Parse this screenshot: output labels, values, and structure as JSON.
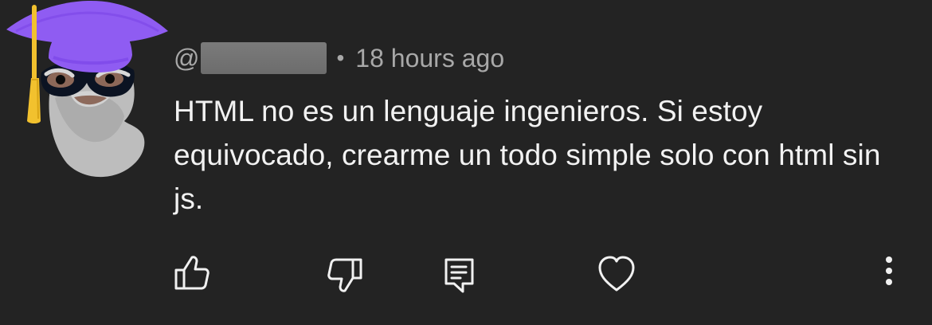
{
  "comment": {
    "at_symbol": "@",
    "separator": "•",
    "timestamp": "18 hours ago",
    "text": "HTML no es un lenguaje ingenieros. Si estoy equivocado, crearme un todo simple solo con html sin js."
  },
  "actions": {
    "like": "thumbs-up-icon",
    "dislike": "thumbs-down-icon",
    "reply": "comment-icon",
    "heart": "heart-icon",
    "more": "more-vertical-icon"
  },
  "colors": {
    "background": "#232323",
    "text": "#f2f2f2",
    "muted": "#a8a8a8",
    "avatar_hat": "#8f5cf2",
    "avatar_tassel": "#f2c12e"
  }
}
